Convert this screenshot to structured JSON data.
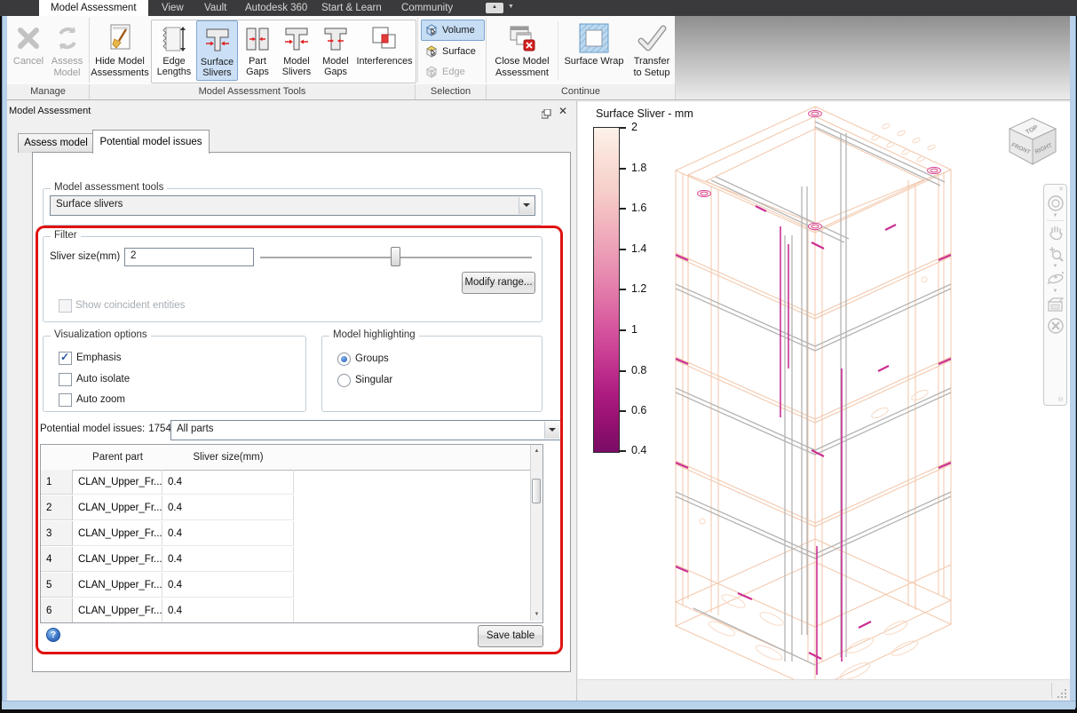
{
  "tabbar": {
    "tabs": [
      {
        "label": "Model Assessment",
        "active": true
      },
      {
        "label": "View"
      },
      {
        "label": "Vault"
      },
      {
        "label": "Autodesk 360"
      },
      {
        "label": "Start & Learn"
      },
      {
        "label": "Community"
      }
    ]
  },
  "ribbon": {
    "manage": {
      "label": "Manage",
      "cancel": "Cancel",
      "assess_model": "Assess Model"
    },
    "tools": {
      "label": "Model Assessment Tools",
      "hide": "Hide Model Assessments",
      "edge_lengths": "Edge Lengths",
      "surface_slivers": "Surface Slivers",
      "part_gaps": "Part Gaps",
      "model_slivers": "Model Slivers",
      "model_gaps": "Model Gaps",
      "interferences": "Interferences",
      "active_tool": "Surface Slivers"
    },
    "selection": {
      "label": "Selection",
      "volume": "Volume",
      "surface": "Surface",
      "edge": "Edge",
      "active": "Volume"
    },
    "continue": {
      "label": "Continue",
      "close": "Close Model Assessment",
      "surface_wrap": "Surface Wrap",
      "transfer": "Transfer to Setup"
    }
  },
  "panel": {
    "title": "Model Assessment",
    "tab_assess": "Assess model",
    "tab_issues": "Potential model issues",
    "active_tab": "Potential model issues",
    "tools_box": {
      "label": "Model assessment tools",
      "value": "Surface slivers"
    },
    "filter": {
      "label": "Filter",
      "size_label": "Sliver size(mm)",
      "size_value": "2",
      "modify_button": "Modify range...",
      "coincident_label": "Show coincident entities"
    },
    "visualization": {
      "label": "Visualization options",
      "emphasis": "Emphasis",
      "auto_isolate": "Auto isolate",
      "auto_zoom": "Auto zoom",
      "checked": "Emphasis"
    },
    "highlighting": {
      "label": "Model highlighting",
      "groups": "Groups",
      "singular": "Singular",
      "selected": "Groups"
    },
    "issues_label": "Potential model issues:",
    "issues_count": "1754",
    "issues_combo": "All parts",
    "table": {
      "col_parent": "Parent part",
      "col_size": "Sliver size(mm)",
      "rows": [
        {
          "num": "1",
          "parent": "CLAN_Upper_Fr...",
          "size": "0.4"
        },
        {
          "num": "2",
          "parent": "CLAN_Upper_Fr...",
          "size": "0.4"
        },
        {
          "num": "3",
          "parent": "CLAN_Upper_Fr...",
          "size": "0.4"
        },
        {
          "num": "4",
          "parent": "CLAN_Upper_Fr...",
          "size": "0.4"
        },
        {
          "num": "5",
          "parent": "CLAN_Upper_Fr...",
          "size": "0.4"
        },
        {
          "num": "6",
          "parent": "CLAN_Upper_Fr...",
          "size": "0.4"
        }
      ]
    },
    "save_button": "Save table"
  },
  "viewport": {
    "legend": {
      "title": "Surface Sliver - mm",
      "ticks": [
        "2",
        "1.8",
        "1.6",
        "1.4",
        "1.2",
        "1",
        "0.8",
        "0.6",
        "0.4"
      ],
      "range_max": 2,
      "range_min": 0.4,
      "top_color": "#fdf2ea",
      "mid_color": "#db62a2",
      "bottom_color": "#7a0c66"
    },
    "viewcube": {
      "top": "TOP",
      "front": "FRONT",
      "right": "RIGHT"
    }
  },
  "colors": {
    "highlight_red": "#e01212",
    "ribbon_active_blue": "#cbe0f6",
    "wire_peach": "#f2c6a9",
    "wire_grey": "#b3b3b3",
    "sliver_magenta": "#cb2f92"
  }
}
